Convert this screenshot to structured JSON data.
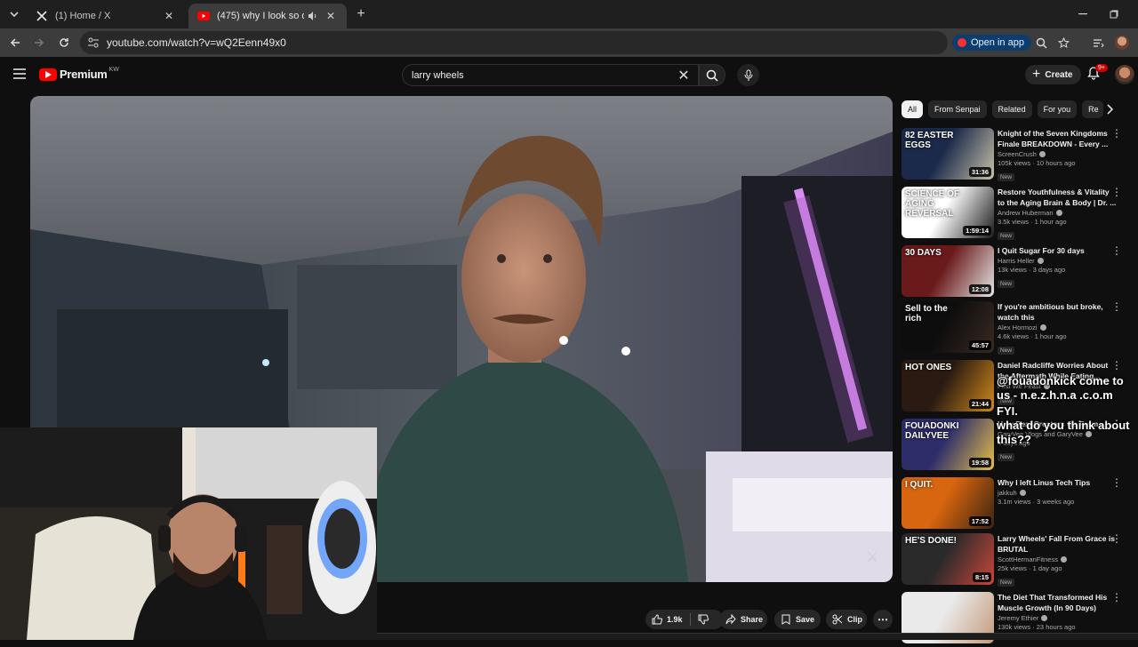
{
  "browser": {
    "tabs": [
      {
        "title": "(1) Home / X",
        "icon": "x-logo-icon"
      },
      {
        "title": "(475) why I look so differen",
        "icon": "youtube-icon"
      }
    ],
    "url": "youtube.com/watch?v=wQ2Eenn49x0",
    "open_in_app": "Open in app"
  },
  "masthead": {
    "logo_text": "Premium",
    "region": "KW",
    "search_value": "larry wheels",
    "create_label": "Create",
    "notifications": "9+"
  },
  "actions": {
    "likes": "1.9k",
    "share": "Share",
    "save": "Save",
    "clip": "Clip"
  },
  "chips": [
    "All",
    "From Senpai",
    "Related",
    "For you",
    "Re"
  ],
  "recommendations": [
    {
      "title": "Knight of the Seven Kingdoms Finale BREAKDOWN - Every ...",
      "channel": "ScreenCrush",
      "meta": "105k views · 10 hours ago",
      "badge": "New",
      "duration": "31:36",
      "overlay": "82 EASTER EGGS",
      "colors": [
        "#1b2a4a",
        "#c9c2a8"
      ]
    },
    {
      "title": "Restore Youthfulness & Vitality to the Aging Brain & Body | Dr. ...",
      "channel": "Andrew Huberman",
      "meta": "3.5k views · 1 hour ago",
      "badge": "New",
      "duration": "1:59:14",
      "overlay": "SCIENCE OF AGING REVERSAL",
      "colors": [
        "#ffffff",
        "#1a1a1a"
      ]
    },
    {
      "title": "I Quit Sugar For 30 days",
      "channel": "Harris Heller",
      "meta": "13k views · 3 days ago",
      "badge": "New",
      "duration": "12:08",
      "overlay": "30 DAYS",
      "colors": [
        "#6a1a1a",
        "#e6e6e6"
      ]
    },
    {
      "title": "If you're ambitious but broke, watch this",
      "channel": "Alex Hormozi",
      "meta": "4.6k views · 1 hour ago",
      "badge": "New",
      "duration": "45:57",
      "overlay": "Sell to the rich",
      "colors": [
        "#0d0d0d",
        "#3a2a22"
      ]
    },
    {
      "title": "Daniel Radcliffe Worries About the Aftermath While Eating...",
      "channel": "First We Feast",
      "meta": "",
      "badge": "New",
      "duration": "21:44",
      "overlay": "HOT ONES",
      "colors": [
        "#2a1a12",
        "#d18a1a"
      ]
    },
    {
      "title": "How Real Creators Go From...",
      "channel": "GaryVee Vlogs and GaryVee",
      "meta": "4 days ago",
      "badge": "New",
      "duration": "19:58",
      "overlay": "FOUADONKI DAILYVEE",
      "colors": [
        "#2d2d6a",
        "#e6c04a"
      ]
    },
    {
      "title": "Why I left Linus Tech Tips",
      "channel": "jakkuh",
      "meta": "3.1m views · 3 weeks ago",
      "badge": "",
      "duration": "17:52",
      "overlay": "I QUIT.",
      "colors": [
        "#d8650f",
        "#3a2410"
      ]
    },
    {
      "title": "Larry Wheels' Fall From Grace is BRUTAL",
      "channel": "ScottHermanFitness",
      "meta": "25k views · 1 day ago",
      "badge": "New",
      "duration": "8:15",
      "overlay": "HE'S DONE!",
      "colors": [
        "#2a2a2a",
        "#c8463a"
      ]
    },
    {
      "title": "The Diet That Transformed His Muscle Growth (In 90 Days)",
      "channel": "Jeremy Ethier",
      "meta": "130k views · 23 hours ago",
      "badge": "",
      "duration": "",
      "overlay": "",
      "colors": [
        "#eaeaea",
        "#c49a7a"
      ]
    }
  ],
  "chat_overlay": {
    "line1": "@fouadonkick come to us - n.e.z.h.n.a .c.o.m",
    "line2": "FYI.",
    "line3": "what do you think about this??"
  }
}
